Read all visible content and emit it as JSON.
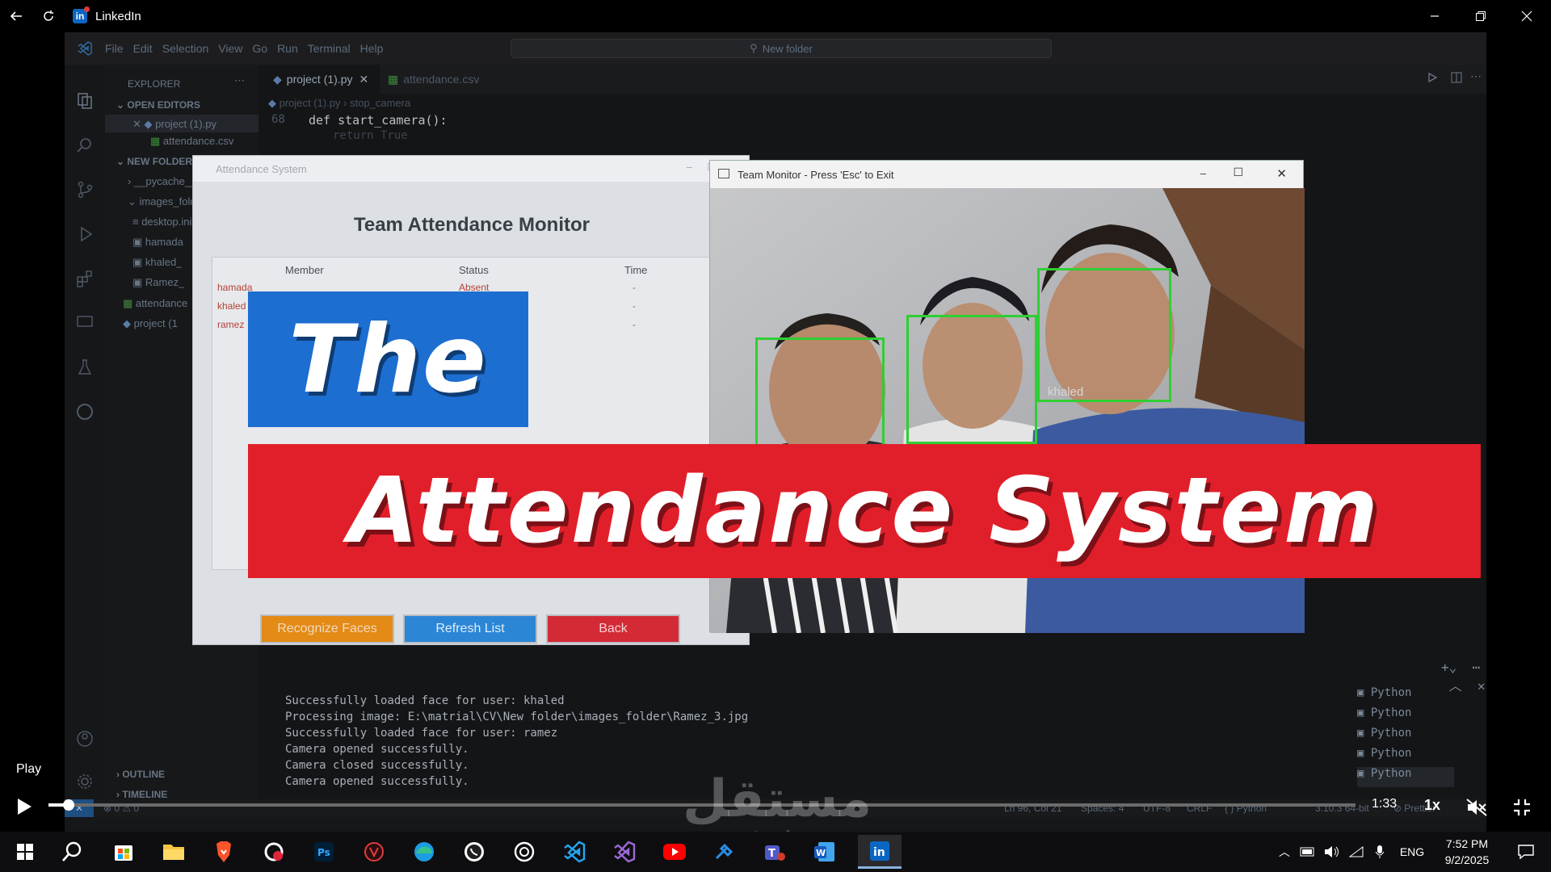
{
  "app": {
    "title": "LinkedIn"
  },
  "vscode": {
    "menu": [
      "File",
      "Edit",
      "Selection",
      "View",
      "Go",
      "Run",
      "Terminal",
      "Help"
    ],
    "search_text": "New folder",
    "tabs": [
      {
        "label": "project (1).py",
        "active": true
      },
      {
        "label": "attendance.csv",
        "active": false
      }
    ],
    "breadcrumb": {
      "file": "project (1).py",
      "symbol": "stop_camera"
    },
    "code_lines": [
      {
        "num": "68",
        "text": "def start_camera():"
      },
      {
        "num": "",
        "text": "return True"
      }
    ],
    "explorer": {
      "title": "EXPLORER",
      "open_editors": "OPEN EDITORS",
      "open_files": [
        "project (1).py",
        "attendance.csv"
      ],
      "folder": "NEW FOLDER",
      "items": [
        "__pycache__",
        "images_folder",
        "desktop.ini",
        "hamada",
        "khaled_",
        "Ramez_",
        "attendance",
        "project (1"
      ],
      "outline": "OUTLINE",
      "timeline": "TIMELINE"
    },
    "terminal_lines": [
      "Successfully loaded face for user: khaled",
      "Processing image: E:\\matrial\\CV\\New folder\\images_folder\\Ramez_3.jpg",
      "Successfully loaded face for user: ramez",
      "Camera opened successfully.",
      "Camera closed successfully.",
      "Camera opened successfully."
    ],
    "terminal_panel": [
      "Python",
      "Python",
      "Python",
      "Python",
      "Python"
    ],
    "status": {
      "problems": "⊗ 0 ⚠ 0",
      "position": "Ln 96, Col 21",
      "spaces": "Spaces: 4",
      "encoding": "UTF-8",
      "eol": "CRLF",
      "language": "Python",
      "interpreter": "3.10.3 64-bit",
      "formatter": "Prettier"
    }
  },
  "attendance_window": {
    "title": "Attendance System",
    "heading": "Team Attendance Monitor",
    "columns": [
      "Member",
      "Status",
      "Time"
    ],
    "rows": [
      {
        "member": "hamada",
        "status": "Absent",
        "time": "-"
      },
      {
        "member": "khaled",
        "status": "",
        "time": "-"
      },
      {
        "member": "ramez",
        "status": "",
        "time": "-"
      }
    ],
    "buttons": {
      "recognize": "Recognize Faces",
      "refresh": "Refresh List",
      "back": "Back"
    },
    "colors": {
      "recognize": "#e38b16",
      "refresh": "#2c86d6",
      "back": "#d32a36"
    }
  },
  "camera_window": {
    "title": "Team Monitor - Press 'Esc' to Exit",
    "face_label": "khaled"
  },
  "thumbnail": {
    "line1": "The",
    "line2": "Attendance System",
    "blue": "#1d6ed1",
    "red": "#e11f2a"
  },
  "player": {
    "play_label": "Play",
    "time": "1:33",
    "speed": "1x",
    "progress": 0.0156
  },
  "watermark": {
    "arabic": "مستقل",
    "latin": "mostaql.com"
  },
  "taskbar": {
    "language": "ENG",
    "time": "7:52 PM",
    "date": "9/2/2025"
  }
}
